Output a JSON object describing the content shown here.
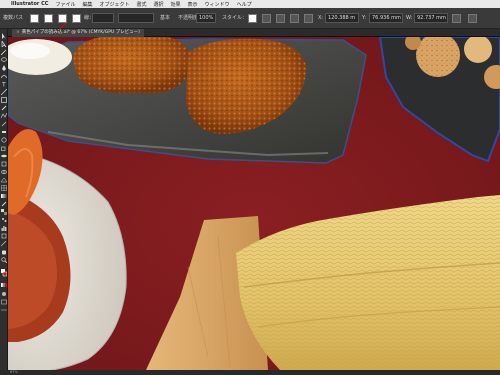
{
  "menubar": {
    "app_name": "Illustrator CC",
    "items": [
      "ファイル",
      "編集",
      "オブジェクト",
      "書式",
      "選択",
      "効果",
      "表示",
      "ウィンドウ",
      "ヘルプ"
    ]
  },
  "control_bar": {
    "selection_label": "複数パス",
    "stroke_label": "線：",
    "brush_label": "基本",
    "opacity_label": "不透明度",
    "opacity_value": "100%",
    "style_label": "スタイル：",
    "x_value": "120.388 m",
    "y_value": "76.936 mm",
    "w_value": "92.737 mm"
  },
  "document_tab": {
    "title": "黄色パイプの読み込.ai* @ 67% (CMYK/GPU プレビュー)"
  },
  "status_bar": {
    "zoom": "67%"
  },
  "colors": {
    "background": "#7c1a1d",
    "panel": "#3a3a3a",
    "menubar": "#e9e9e9"
  }
}
